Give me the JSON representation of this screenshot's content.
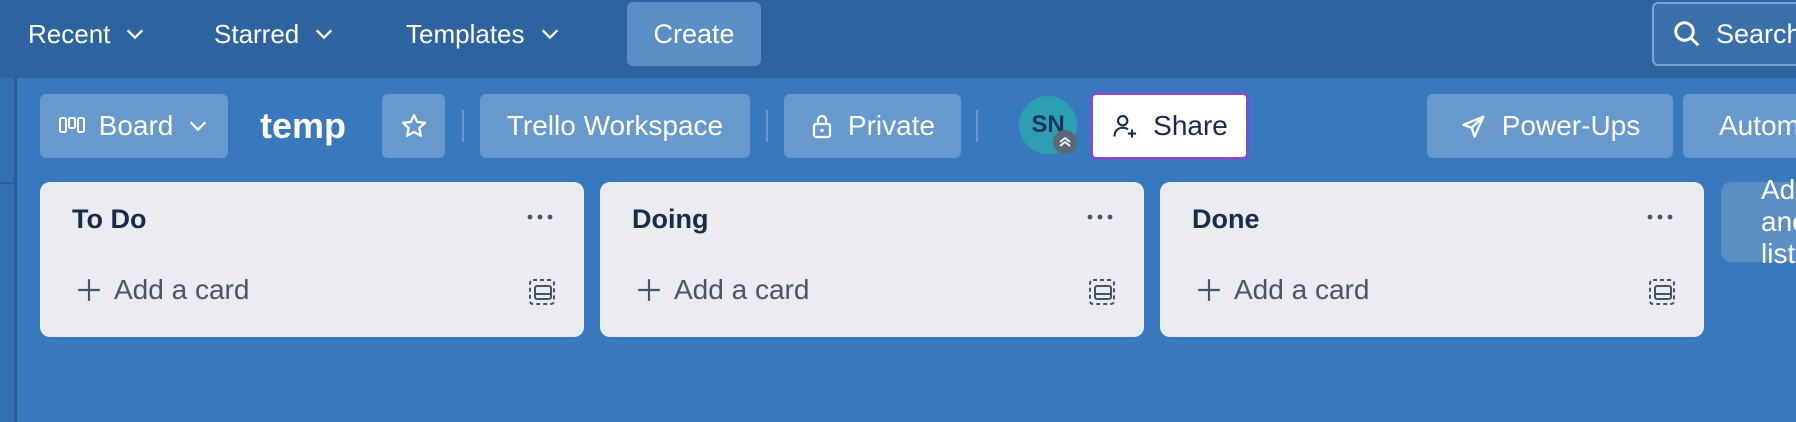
{
  "topnav": {
    "items": [
      {
        "label": "Recent"
      },
      {
        "label": "Starred"
      },
      {
        "label": "Templates"
      }
    ],
    "create_label": "Create",
    "search_placeholder": "Search"
  },
  "board_header": {
    "view_label": "Board",
    "title": "temp",
    "workspace_label": "Trello Workspace",
    "visibility_label": "Private",
    "avatar_initials": "SN",
    "share_label": "Share",
    "powerups_label": "Power-Ups",
    "automation_label": "Automation"
  },
  "lists": [
    {
      "title": "To Do",
      "add_label": "Add a card"
    },
    {
      "title": "Doing",
      "add_label": "Add a card"
    },
    {
      "title": "Done",
      "add_label": "Add a card"
    }
  ],
  "add_list_label": "Add another list",
  "colors": {
    "topnav_bg": "#2d64a0",
    "board_bg": "#3878bd",
    "button_bg": "#6899cc",
    "list_bg": "#ebecf0",
    "share_border": "#7a4fd1",
    "avatar_bg": "#2e9fb3"
  }
}
